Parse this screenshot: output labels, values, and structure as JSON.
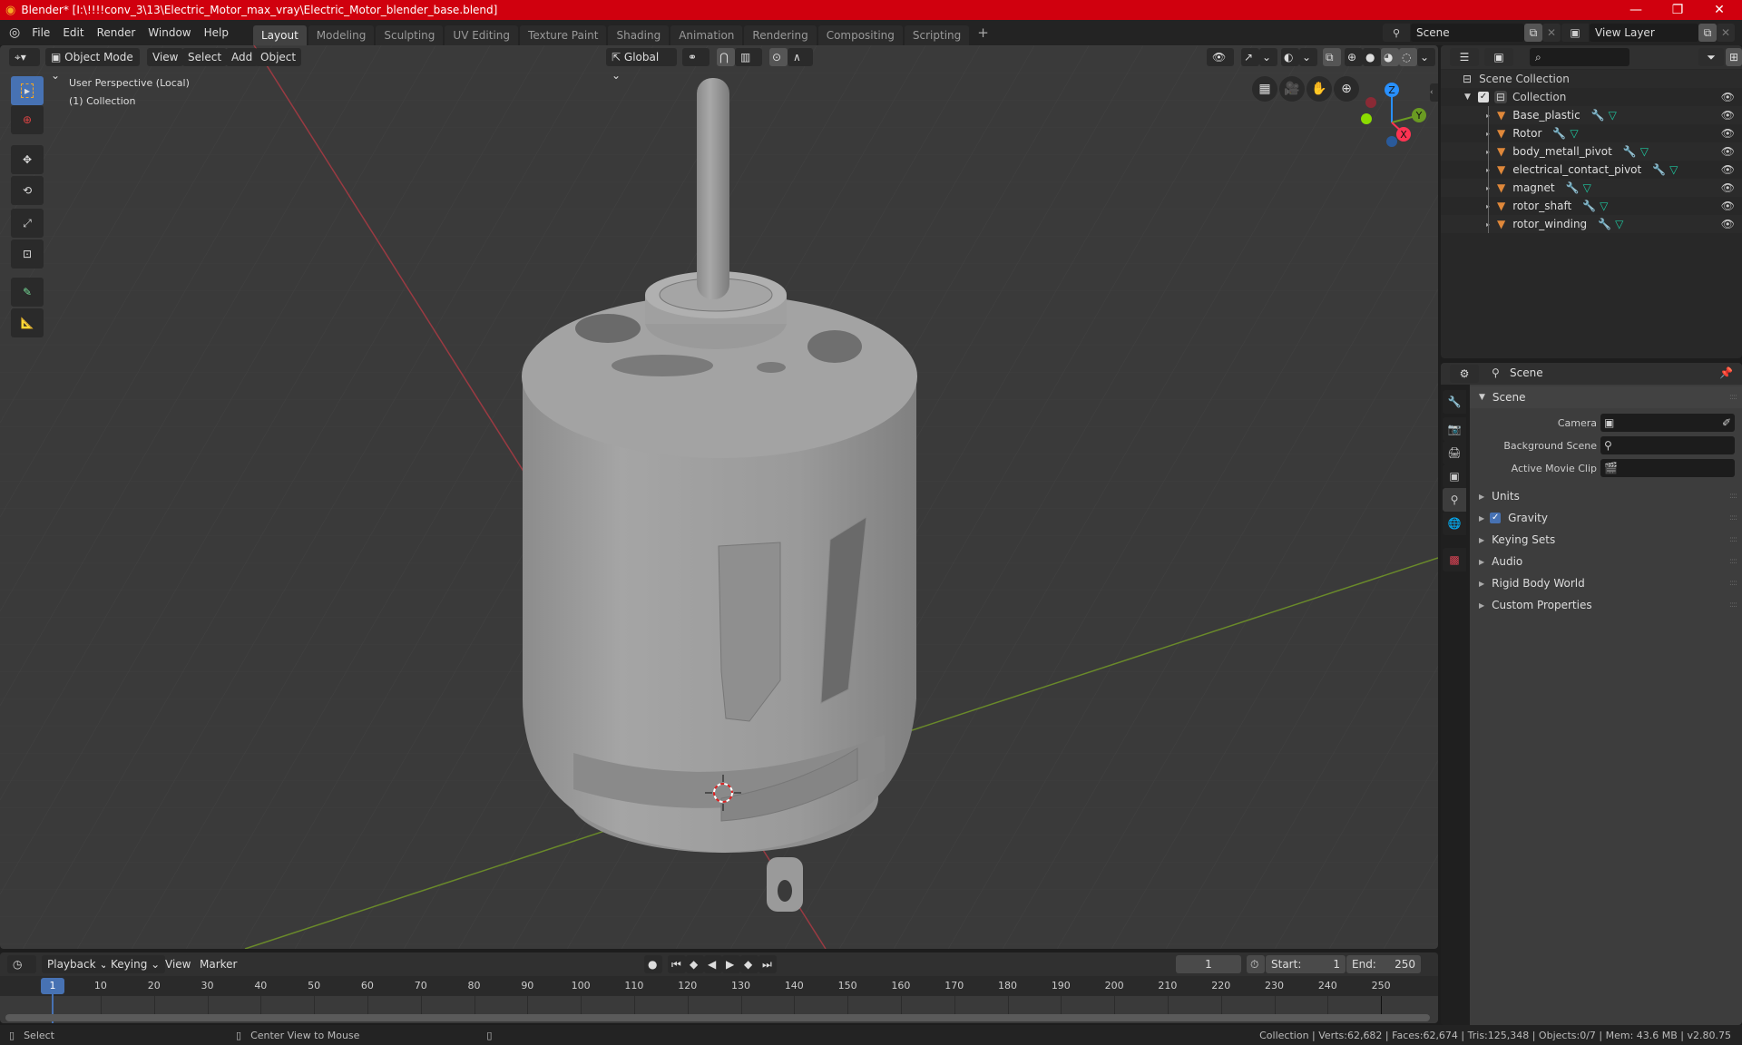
{
  "window": {
    "title": "Blender* [I:\\!!!!conv_3\\13\\Electric_Motor_max_vray\\Electric_Motor_blender_base.blend]",
    "controls": [
      "minimize",
      "maximize",
      "close"
    ]
  },
  "menubar": {
    "menus": [
      "File",
      "Edit",
      "Render",
      "Window",
      "Help"
    ],
    "workspaces": [
      "Layout",
      "Modeling",
      "Sculpting",
      "UV Editing",
      "Texture Paint",
      "Shading",
      "Animation",
      "Rendering",
      "Compositing",
      "Scripting"
    ],
    "active_workspace": "Layout",
    "add_workspace": "+",
    "scene": "Scene",
    "view_layer": "View Layer"
  },
  "viewport": {
    "mode": "Object Mode",
    "menus": [
      "View",
      "Select",
      "Add",
      "Object"
    ],
    "transform_orientation": "Global",
    "overlay_text_1": "User Perspective (Local)",
    "overlay_text_2": "(1) Collection",
    "shading_active": "solid",
    "gizmo_axes": [
      "X",
      "Y",
      "Z"
    ],
    "tools": [
      "select-box",
      "cursor",
      "move",
      "rotate",
      "scale",
      "transform",
      "annotate",
      "measure"
    ]
  },
  "outliner": {
    "root": "Scene Collection",
    "collection": "Collection",
    "objects": [
      {
        "name": "Base_plastic"
      },
      {
        "name": "Rotor"
      },
      {
        "name": "body_metall_pivot"
      },
      {
        "name": "electrical_contact_pivot"
      },
      {
        "name": "magnet"
      },
      {
        "name": "rotor_shaft"
      },
      {
        "name": "rotor_winding"
      }
    ]
  },
  "properties": {
    "context": "Scene",
    "panel_title": "Scene",
    "fields": [
      {
        "label": "Camera",
        "value": ""
      },
      {
        "label": "Background Scene",
        "value": ""
      },
      {
        "label": "Active Movie Clip",
        "value": ""
      }
    ],
    "subpanels": [
      {
        "label": "Units",
        "checkbox": false
      },
      {
        "label": "Gravity",
        "checkbox": true,
        "checked": true
      },
      {
        "label": "Keying Sets",
        "checkbox": false
      },
      {
        "label": "Audio",
        "checkbox": false
      },
      {
        "label": "Rigid Body World",
        "checkbox": false
      },
      {
        "label": "Custom Properties",
        "checkbox": false
      }
    ]
  },
  "timeline": {
    "menus": [
      "Playback",
      "Keying",
      "View",
      "Marker"
    ],
    "current_frame": "1",
    "start_label": "Start:",
    "start": "1",
    "end_label": "End:",
    "end": "250",
    "ruler_ticks": [
      "10",
      "20",
      "30",
      "40",
      "50",
      "60",
      "70",
      "80",
      "90",
      "100",
      "110",
      "120",
      "130",
      "140",
      "150",
      "160",
      "170",
      "180",
      "190",
      "200",
      "210",
      "220",
      "230",
      "240",
      "250"
    ],
    "playhead_label": "1"
  },
  "statusbar": {
    "hint_1": "Select",
    "hint_2": "Center View to Mouse",
    "stats": "Collection | Verts:62,682 | Faces:62,674 | Tris:125,348 | Objects:0/7 | Mem: 43.6 MB | v2.80.75"
  },
  "colors": {
    "titlebar": "#d0000e",
    "accent": "#4772b3",
    "mesh_icon": "#e0883a",
    "modifier_icon": "#6c9ae0",
    "vertex_icon": "#1ec8a0",
    "axis_x": "#ff3352",
    "axis_y": "#8bdc00",
    "axis_z": "#2890ff"
  }
}
